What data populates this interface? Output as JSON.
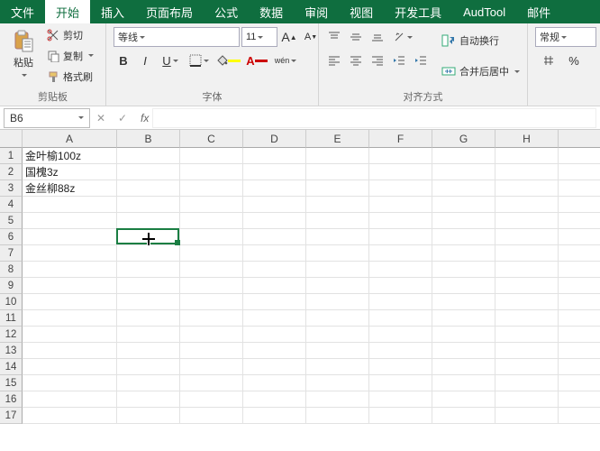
{
  "tabs": [
    "文件",
    "开始",
    "插入",
    "页面布局",
    "公式",
    "数据",
    "审阅",
    "视图",
    "开发工具",
    "AudTool",
    "邮件"
  ],
  "active_tab": "开始",
  "clipboard": {
    "label": "剪贴板",
    "paste": "粘贴",
    "cut": "剪切",
    "copy": "复制",
    "format_painter": "格式刷"
  },
  "font": {
    "label": "字体",
    "name": "等线",
    "size": "11",
    "bold": "B",
    "italic": "I",
    "underline": "U",
    "fill_color": "#ffff00",
    "font_color": "#cc0000",
    "border_color": "#333",
    "ruby": "wén"
  },
  "align": {
    "label": "对齐方式",
    "wrap": "自动换行",
    "merge": "合并后居中"
  },
  "number": {
    "label": "",
    "format": "常规",
    "percent": "%"
  },
  "namebox": "B6",
  "fx": "fx",
  "fxbtn_cancel": "✕",
  "fxbtn_ok": "✓",
  "columns": [
    "A",
    "B",
    "C",
    "D",
    "E",
    "F",
    "G",
    "H"
  ],
  "row_count": 17,
  "cells": {
    "A1": "金叶榆100z",
    "A2": "国槐3z",
    "A3": "金丝柳88z"
  },
  "selection": {
    "col": 1,
    "row": 5,
    "ref": "B6"
  }
}
